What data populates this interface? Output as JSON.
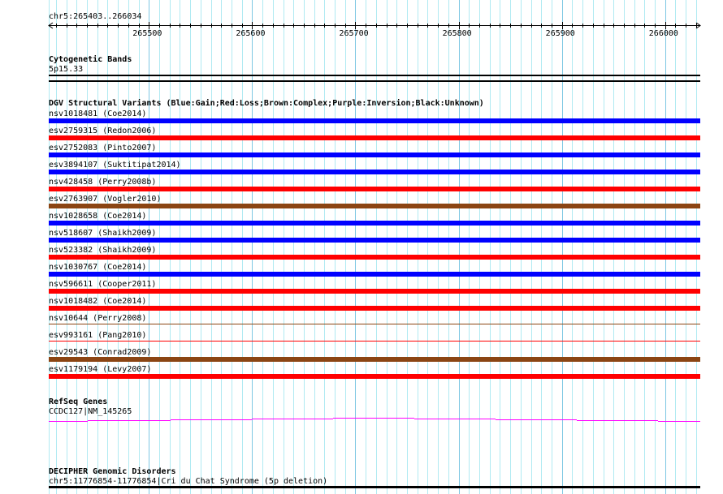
{
  "ruler": {
    "position": "chr5:265403..266034",
    "start": 265403,
    "end": 266034,
    "tick_labels": [
      "265500",
      "265600",
      "265700",
      "265800",
      "265900",
      "266000"
    ]
  },
  "cytoband": {
    "title": "Cytogenetic Bands",
    "band": "5p15.33"
  },
  "dgv": {
    "title": "DGV Structural Variants (Blue:Gain;Red:Loss;Brown:Complex;Purple:Inversion;Black:Unknown)",
    "colors": {
      "gain": "#0000ff",
      "loss": "#ff0000",
      "complex": "#8b4513"
    },
    "variants": [
      {
        "label": "nsv1018481 (Coe2014)",
        "type": "gain"
      },
      {
        "label": "esv2759315 (Redon2006)",
        "type": "loss"
      },
      {
        "label": "esv2752083 (Pinto2007)",
        "type": "gain"
      },
      {
        "label": "esv3894107 (Suktitipat2014)",
        "type": "gain"
      },
      {
        "label": "nsv428458 (Perry2008b)",
        "type": "loss"
      },
      {
        "label": "esv2763907 (Vogler2010)",
        "type": "complex"
      },
      {
        "label": "nsv1028658 (Coe2014)",
        "type": "gain"
      },
      {
        "label": "nsv518607 (Shaikh2009)",
        "type": "gain"
      },
      {
        "label": "nsv523382 (Shaikh2009)",
        "type": "loss"
      },
      {
        "label": "nsv1030767 (Coe2014)",
        "type": "gain"
      },
      {
        "label": "nsv596611 (Cooper2011)",
        "type": "loss"
      },
      {
        "label": "nsv1018482 (Coe2014)",
        "type": "loss"
      },
      {
        "label": "nsv10644 (Perry2008)",
        "type": "complex",
        "thin": true
      },
      {
        "label": "esv993161 (Pang2010)",
        "type": "loss",
        "thin": true
      },
      {
        "label": "esv29543 (Conrad2009)",
        "type": "complex"
      },
      {
        "label": "esv1179194 (Levy2007)",
        "type": "loss"
      }
    ]
  },
  "refseq": {
    "title": "RefSeq Genes",
    "gene": "CCDC127|NM_145265",
    "color": "#ff00ff"
  },
  "decipher": {
    "title": "DECIPHER Genomic Disorders",
    "region": "chr5:11776854-11776854|Cri du Chat Syndrome (5p deletion)"
  }
}
